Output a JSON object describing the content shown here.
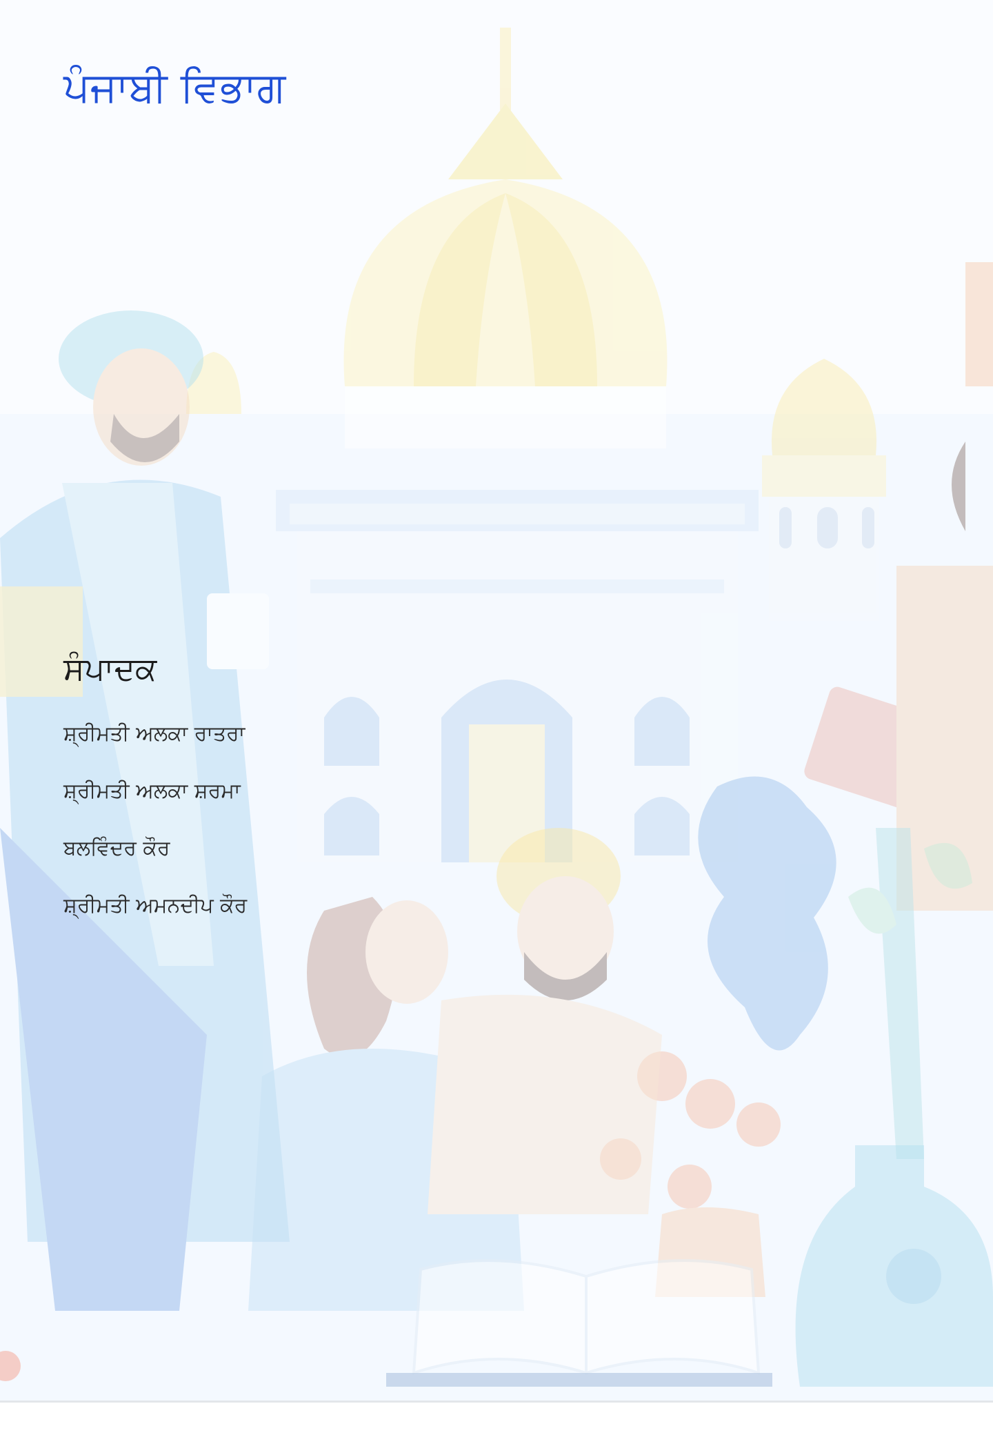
{
  "department_title": "ਪੰਜਾਬੀ ਵਿਭਾਗ",
  "editors": {
    "heading": "ਸੰਪਾਦਕ",
    "names": [
      "ਸ਼੍ਰੀਮਤੀ ਅਲਕਾ ਰਾਤਰਾ",
      "ਸ਼੍ਰੀਮਤੀ ਅਲਕਾ ਸ਼ਰਮਾ",
      "ਬਲਵਿੰਦਰ ਕੌਰ",
      "ਸ਼੍ਰੀਮਤੀ ਅਮਨਦੀਪ ਕੌਰ"
    ]
  },
  "colors": {
    "title": "#1f4fd6",
    "heading": "#1b1b1b",
    "text": "#2a2a2a"
  }
}
